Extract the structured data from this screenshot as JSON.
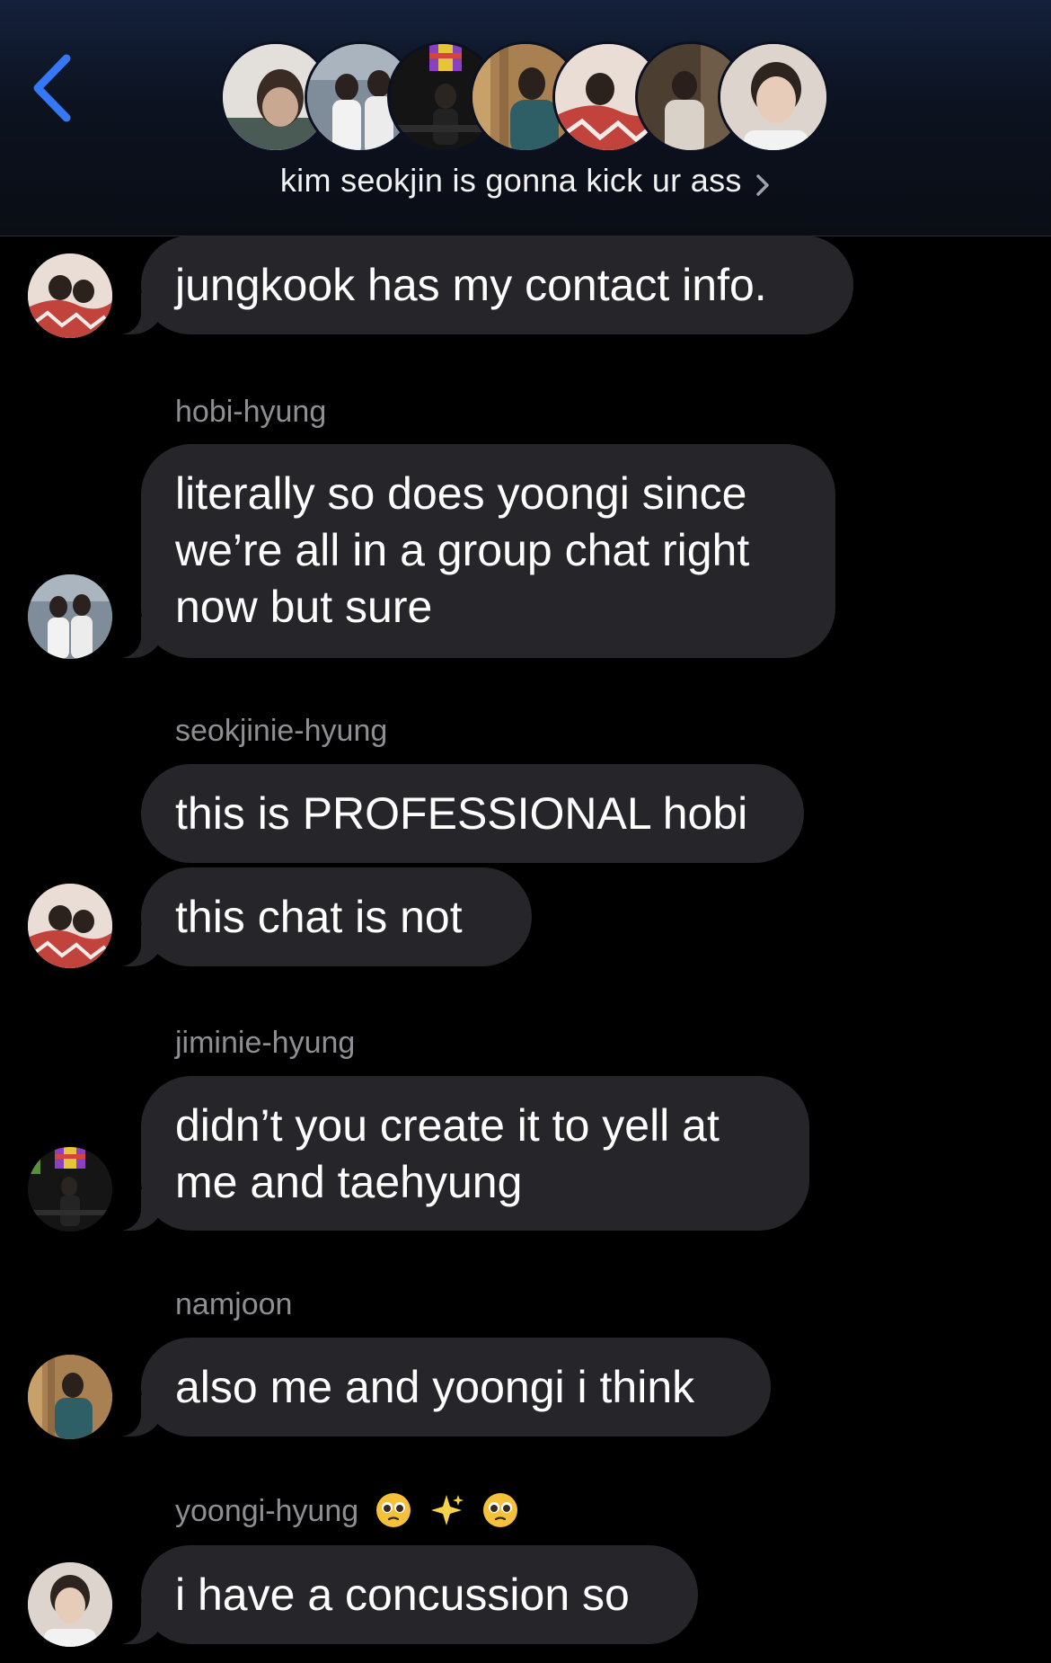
{
  "header": {
    "back_icon": "chevron-left-icon",
    "chat_title": "kim seokjin is gonna kick ur ass",
    "title_chevron_icon": "chevron-right-icon",
    "accent_color": "#3478f6",
    "group_avatar_count": 7
  },
  "messages": [
    {
      "sender": "",
      "text": "jungkook has my contact info.",
      "avatar": "avatar-pink-sweater"
    },
    {
      "sender": "hobi-hyung",
      "text": "literally so does yoongi since we’re all in a group chat right now but sure",
      "avatar": "avatar-white-outfits"
    },
    {
      "sender": "seokjinie-hyung",
      "text": "this is PROFESSIONAL hobi",
      "avatar": ""
    },
    {
      "sender": "",
      "text": "this chat is not",
      "avatar": "avatar-pink-sweater"
    },
    {
      "sender": "jiminie-hyung",
      "text": "didn’t you create it to yell at me and taehyung",
      "avatar": "avatar-stained-glass"
    },
    {
      "sender": "namjoon",
      "text": "also me and yoongi i think",
      "avatar": "avatar-green-sweater"
    },
    {
      "sender": "yoongi-hyung",
      "sender_emojis": [
        "pleading-face-emoji",
        "sparkles-emoji",
        "pleading-face-emoji"
      ],
      "text": "i have a concussion so",
      "avatar": "avatar-portrait"
    }
  ],
  "colors": {
    "bubble": "#26252a",
    "sender_name": "#8e8e93",
    "background": "#000000"
  }
}
